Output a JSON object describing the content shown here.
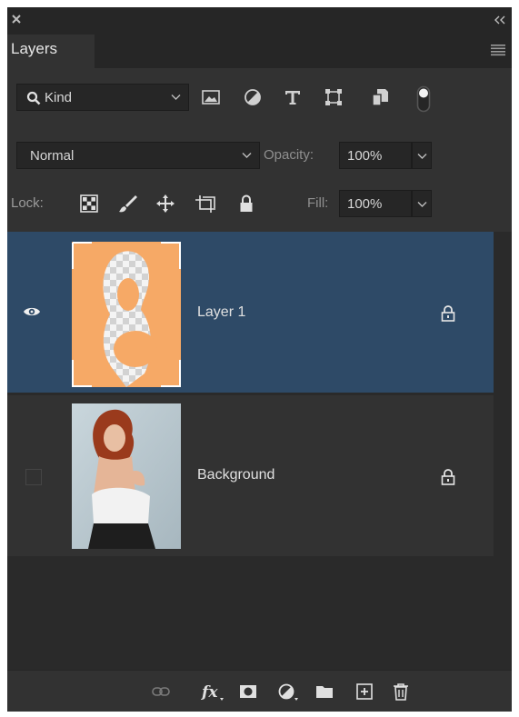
{
  "panel": {
    "tab_label": "Layers",
    "colors": {
      "panel_bg": "#323232",
      "dark_bg": "#262626",
      "selected_row": "#2e4a67",
      "text": "#d6d6d6"
    }
  },
  "filter": {
    "kind_label": "Kind",
    "icons": [
      "pixel-filter-icon",
      "adjustment-filter-icon",
      "type-filter-icon",
      "shape-filter-icon",
      "smart-object-filter-icon",
      "filter-toggle-icon"
    ]
  },
  "blend": {
    "mode": "Normal",
    "opacity_label": "Opacity:",
    "opacity_value": "100%"
  },
  "lock": {
    "label": "Lock:",
    "fill_label": "Fill:",
    "fill_value": "100%",
    "icons": [
      "lock-transparent-pixels-icon",
      "lock-image-pixels-icon",
      "lock-position-icon",
      "lock-artboard-icon",
      "lock-all-icon"
    ]
  },
  "layers": [
    {
      "name": "Layer 1",
      "visible": true,
      "selected": true,
      "locked": true
    },
    {
      "name": "Background",
      "visible": false,
      "selected": false,
      "locked": true
    }
  ],
  "bottom_toolbar": {
    "icons": [
      "link-layers-icon",
      "fx-icon",
      "layer-mask-icon",
      "adjustment-layer-icon",
      "group-folder-icon",
      "new-layer-icon",
      "delete-layer-icon"
    ]
  }
}
